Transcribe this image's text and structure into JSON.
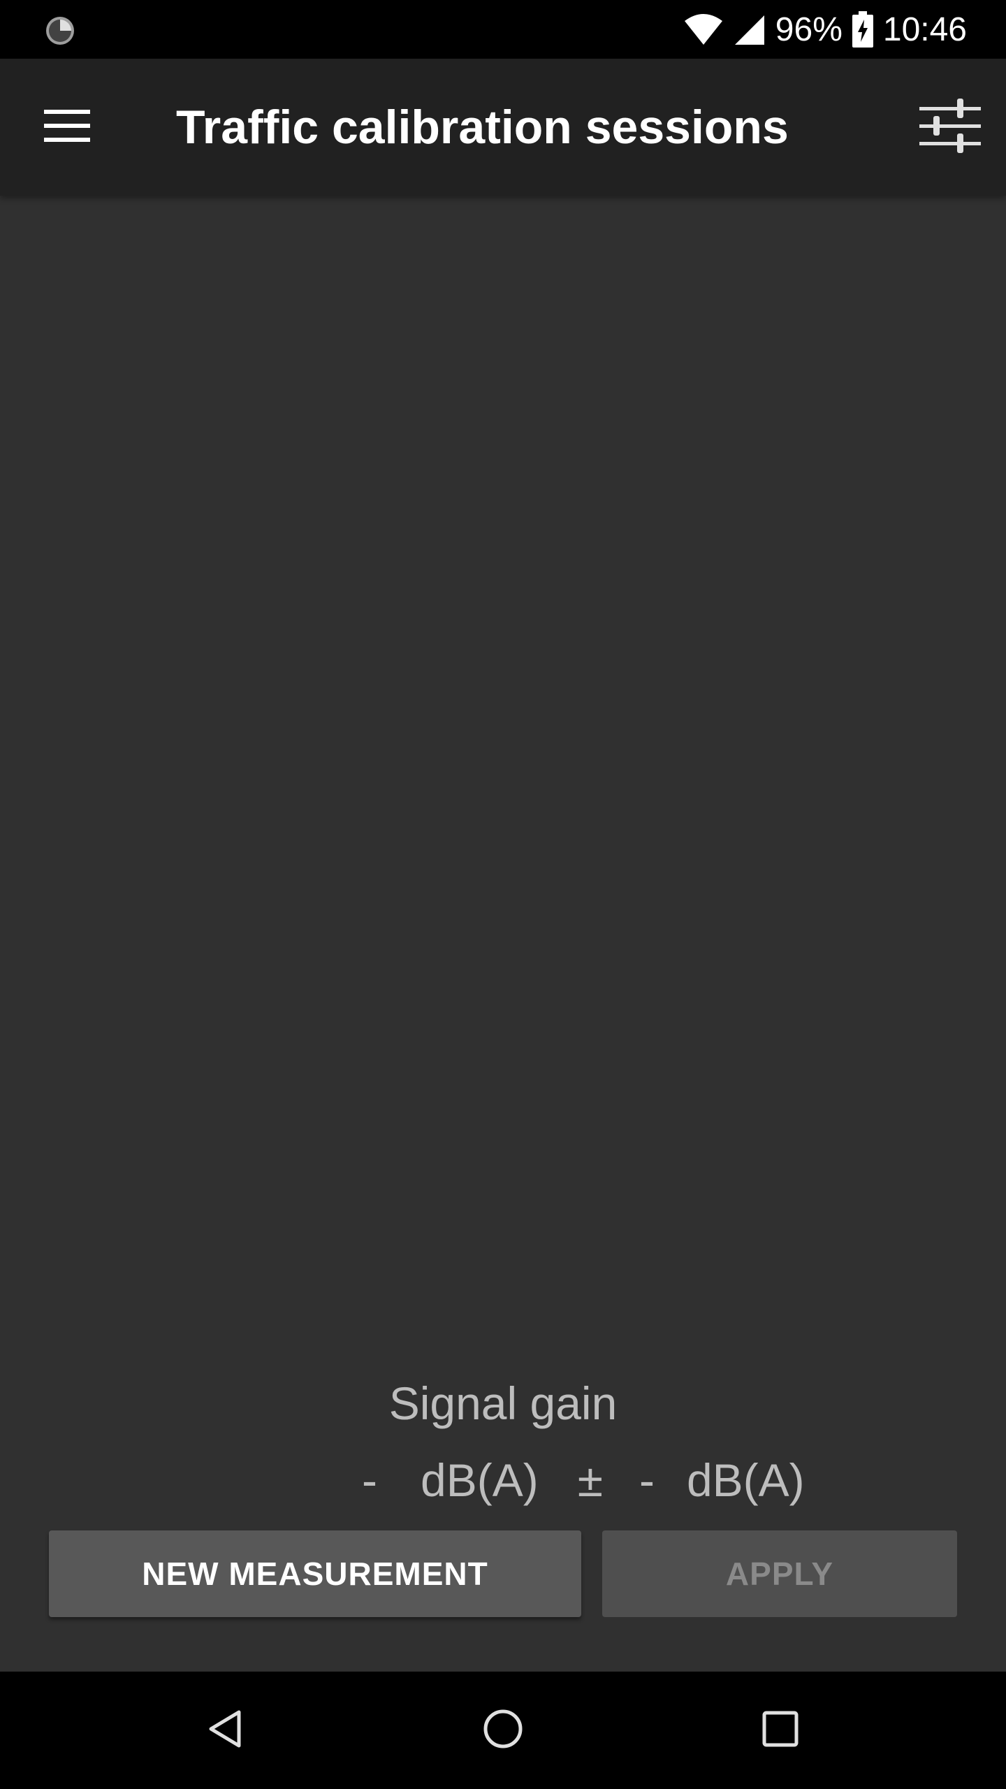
{
  "status_bar": {
    "battery": "96%",
    "time": "10:46"
  },
  "app_bar": {
    "title": "Traffic calibration sessions"
  },
  "gain": {
    "title": "Signal gain",
    "value": "-",
    "unit": "dB(A)",
    "plus_minus": "±",
    "uncertainty": "-",
    "uncertainty_unit": "dB(A)"
  },
  "buttons": {
    "new_measurement": "NEW MEASUREMENT",
    "apply": "APPLY"
  },
  "icons": {
    "status_left": "loading-icon",
    "wifi": "wifi-icon",
    "signal": "cell-signal-icon",
    "battery": "battery-charging-icon",
    "menu": "menu-icon",
    "tune": "tune-icon",
    "back": "back-icon",
    "home": "home-icon",
    "recents": "recents-icon"
  },
  "colors": {
    "background": "#303030",
    "app_bar": "#212121",
    "primary_button": "#585858",
    "disabled_button": "#4f4f4f"
  }
}
